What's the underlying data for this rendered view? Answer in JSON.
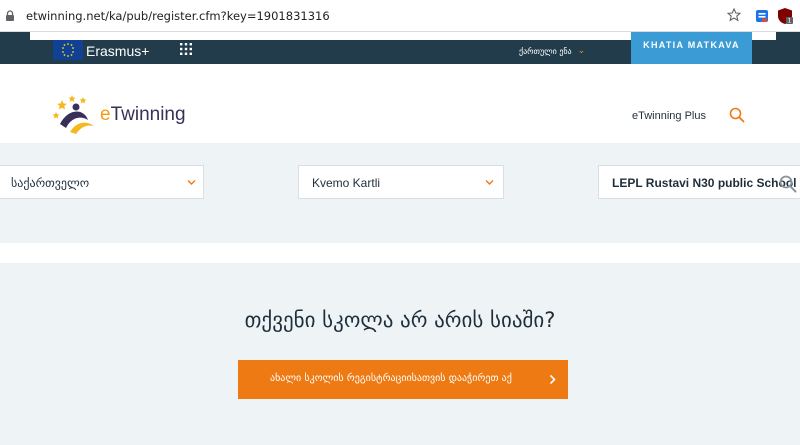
{
  "browser": {
    "url": "etwinning.net/ka/pub/register.cfm?key=1901831316"
  },
  "topbar": {
    "erasmus_label": "Erasmus+",
    "language": "ქართული ენა",
    "user_name": "KHATIA MATKAVA"
  },
  "header": {
    "logo_e": "e",
    "logo_rest": "Twinning",
    "nav_plus": "eTwinning Plus"
  },
  "filters": {
    "country": "საქართველო",
    "region": "Kvemo Kartli",
    "school": "LEPL Rustavi N30 public School"
  },
  "register": {
    "not_listed_text": "თქვენი სკოლა არ არის სიაში?",
    "button_label": "ახალი სკოლის რეგისტრაციისათვის დააჭირეთ აქ"
  },
  "colors": {
    "strip": "#233c4c",
    "user_box": "#3a9bd5",
    "accent_orange": "#ee7a13",
    "band": "#eef3f6"
  },
  "icons": [
    "lock-icon",
    "star-icon",
    "extension-icon",
    "ublock-icon",
    "eu-flag-icon",
    "grid-icon",
    "chevron-down-icon",
    "search-icon",
    "chevron-right-icon"
  ]
}
